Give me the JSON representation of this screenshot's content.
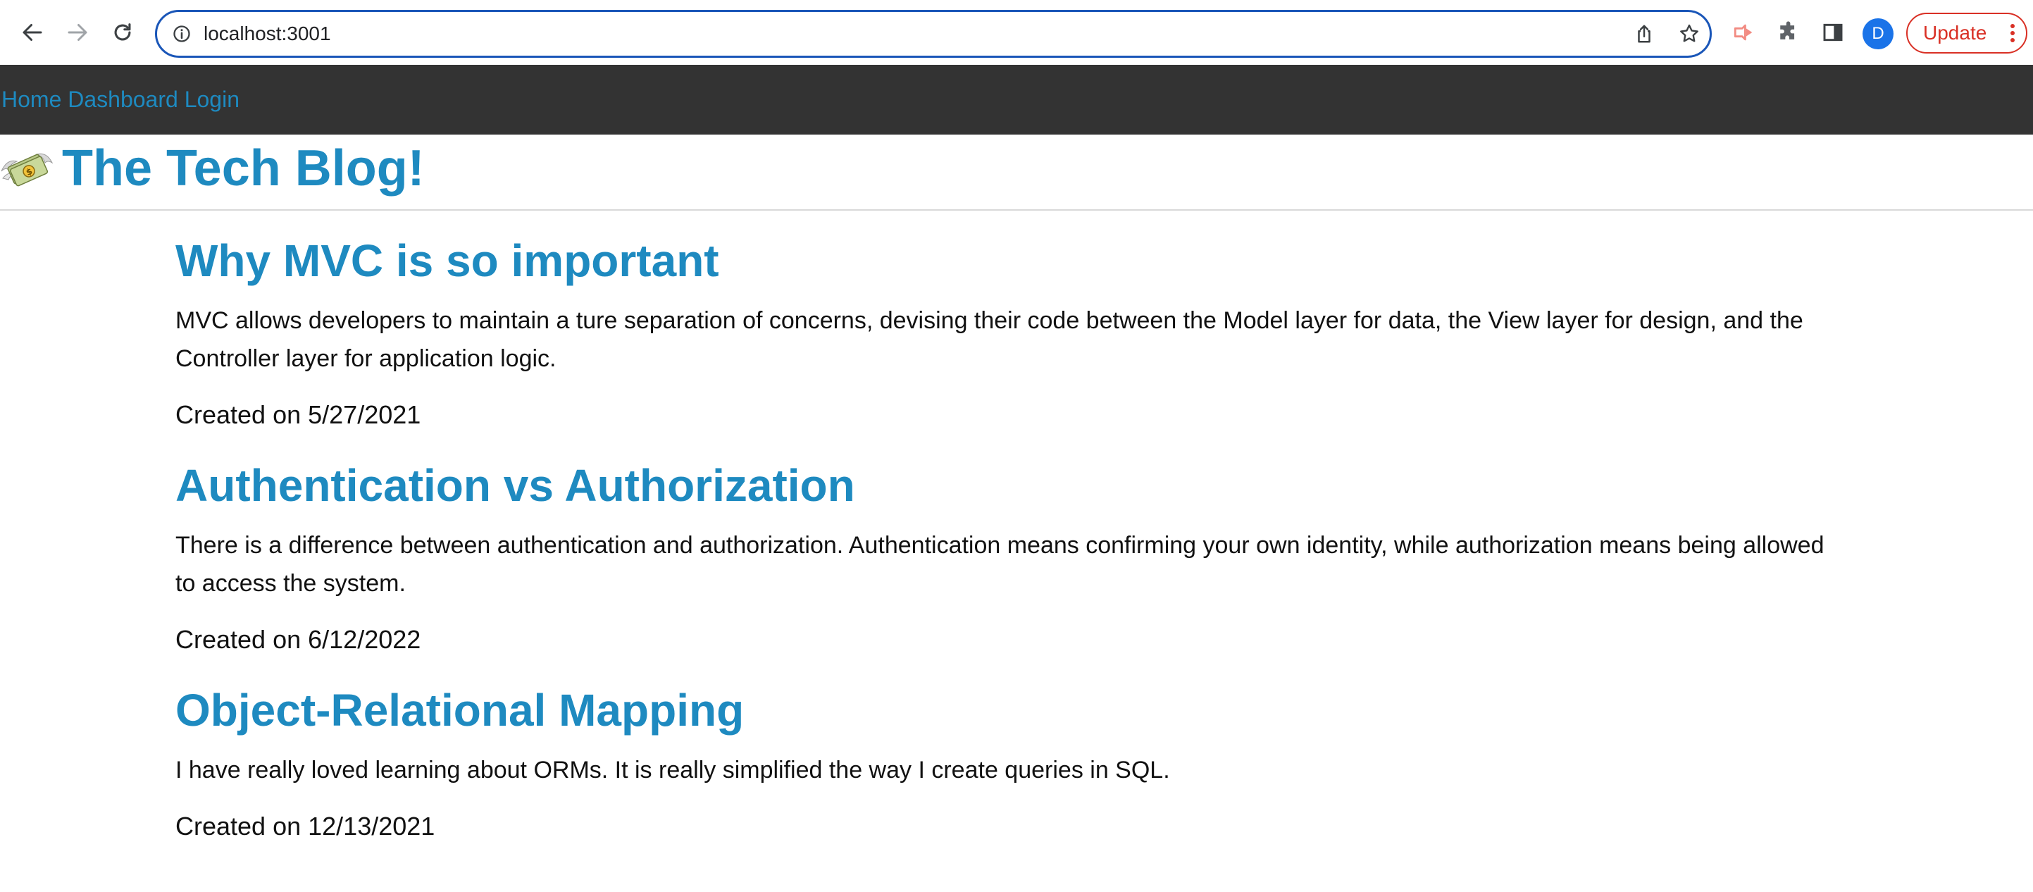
{
  "browser": {
    "url": "localhost:3001",
    "update_label": "Update",
    "profile_initial": "D",
    "accent_color": "#1a56b8",
    "update_color": "#d93025"
  },
  "site": {
    "nav": {
      "home": "Home",
      "dashboard": "Dashboard",
      "login": "Login"
    },
    "title": "The Tech Blog!",
    "logo_icon": "money-with-wings-icon",
    "nav_bg": "#333333",
    "link_color": "#1e8ac0"
  },
  "posts": [
    {
      "title": "Why MVC is so important",
      "body": "MVC allows developers to maintain a ture separation of concerns, devising their code between the Model layer for data, the View layer for design, and the Controller layer for application logic.",
      "date": "Created on 5/27/2021"
    },
    {
      "title": "Authentication vs Authorization",
      "body": "There is a difference between authentication and authorization. Authentication means confirming your own identity, while authorization means being allowed to access the system.",
      "date": "Created on 6/12/2022"
    },
    {
      "title": "Object-Relational Mapping",
      "body": "I have really loved learning about ORMs. It is really simplified the way I create queries in SQL.",
      "date": "Created on 12/13/2021"
    }
  ]
}
